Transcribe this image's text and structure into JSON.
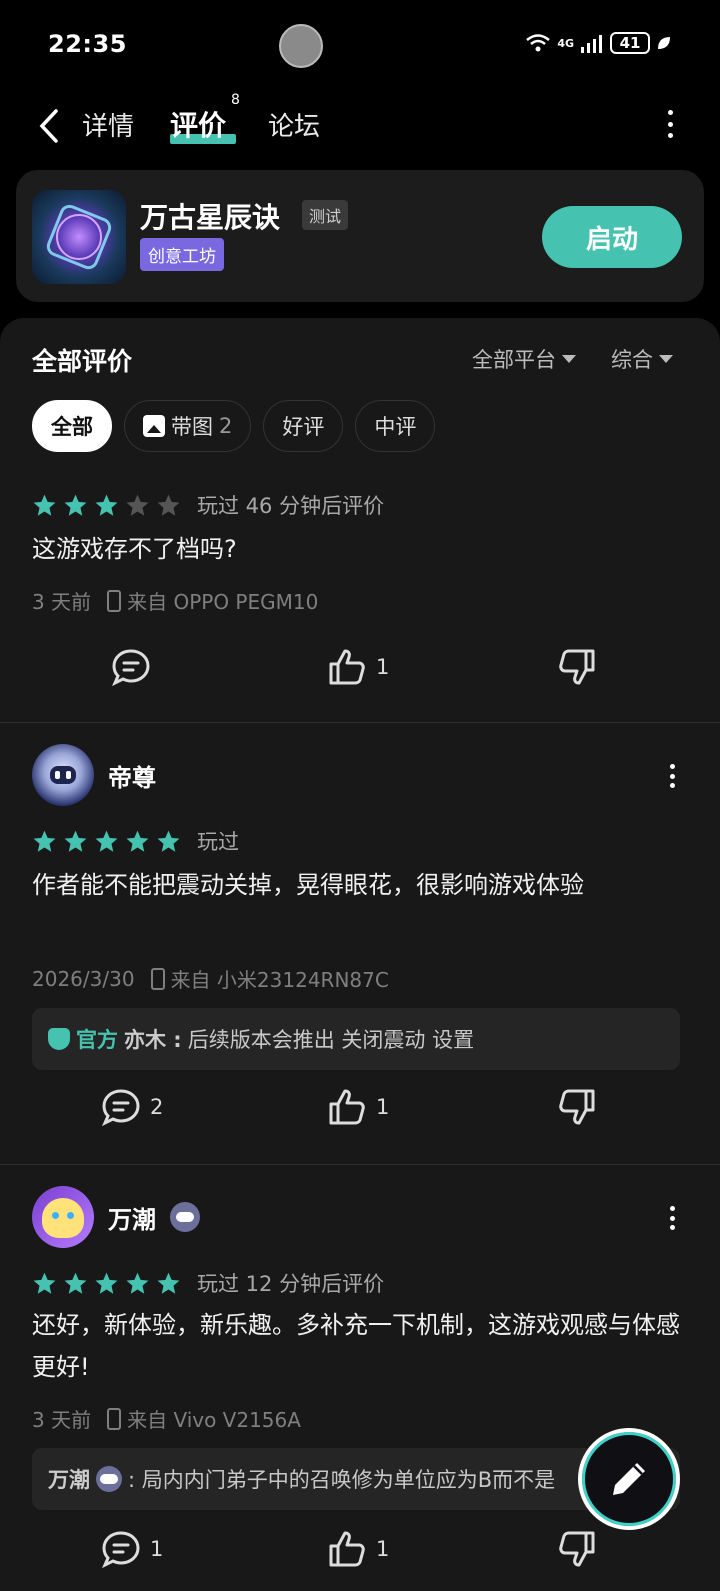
{
  "status_bar": {
    "time": "22:35",
    "network": "4G",
    "battery": "41"
  },
  "nav": {
    "tabs": [
      "详情",
      "评价",
      "论坛"
    ],
    "active_tab": "评价",
    "review_badge": "8"
  },
  "game": {
    "title": "万古星辰诀",
    "tag_test": "测试",
    "tag_workshop": "创意工坊",
    "launch_label": "启动"
  },
  "reviews_header": {
    "title": "全部评价",
    "platform_filter": "全部平台",
    "sort_filter": "综合"
  },
  "chips": [
    {
      "label": "全部",
      "active": true
    },
    {
      "label": "带图",
      "count": "2"
    },
    {
      "label": "好评"
    },
    {
      "label": "中评"
    }
  ],
  "reviews": [
    {
      "rating": 3,
      "played": "玩过 46 分钟后评价",
      "content": "这游戏存不了档吗?",
      "date": "3 天前",
      "device": "来自 OPPO PEGM10",
      "comments": "",
      "likes": "1"
    },
    {
      "user": "帝尊",
      "rating": 5,
      "played": "玩过",
      "content": "作者能不能把震动关掉，晃得眼花，很影响游戏体验",
      "date": "2026/3/30",
      "device": "来自 小米23124RN87C",
      "reply": {
        "badge": "官方",
        "author": "亦木 :",
        "text": "后续版本会推出 关闭震动 设置"
      },
      "comments": "2",
      "likes": "1"
    },
    {
      "user": "万潮",
      "rating": 5,
      "played": "玩过 12 分钟后评价",
      "content": "还好，新体验，新乐趣。多补充一下机制，这游戏观感与体感更好!",
      "date": "3 天前",
      "device": "来自 Vivo V2156A",
      "reply": {
        "author": "万潮",
        "text": ": 局内内门弟子中的召唤修为单位应为B而不是"
      },
      "comments": "1",
      "likes": "1"
    }
  ],
  "colors": {
    "accent": "#45c3b0",
    "workshop": "#7a68e0",
    "star_on": "#45c3b0",
    "star_off": "#555555"
  }
}
